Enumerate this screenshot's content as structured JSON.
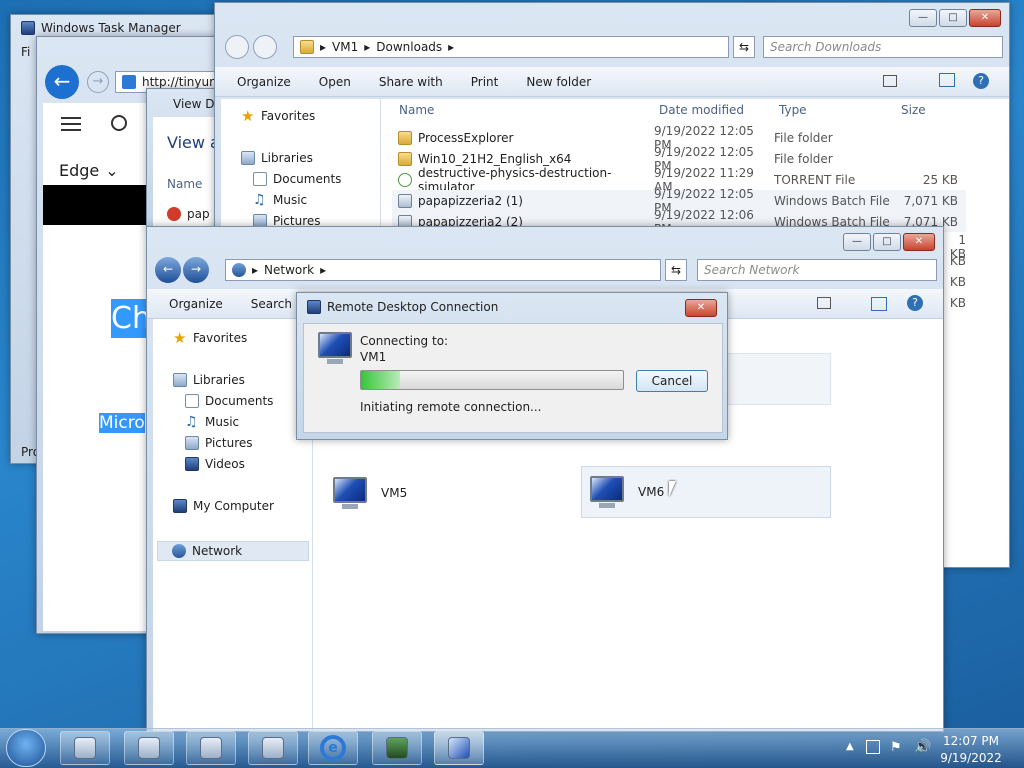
{
  "task_manager": {
    "title": "Windows Task Manager",
    "menu_first": "Fi",
    "status_first": "Pro"
  },
  "edge": {
    "address": "http://tinyurl.",
    "edge_label": "Edge",
    "highlight_big": "Ch",
    "highlight_small": "Micro"
  },
  "view_win": {
    "title": "View Do",
    "heading": "View a",
    "col_name": "Name",
    "row1": "pap"
  },
  "downloads": {
    "address": [
      "VM1",
      "Downloads"
    ],
    "search_placeholder": "Search Downloads",
    "toolbar": [
      "Organize",
      "Open",
      "Share with",
      "Print",
      "New folder"
    ],
    "nav": {
      "favorites": "Favorites",
      "libraries": "Libraries",
      "documents": "Documents",
      "music": "Music",
      "pictures": "Pictures"
    },
    "columns": [
      "Name",
      "Date modified",
      "Type",
      "Size"
    ],
    "files": [
      {
        "name": "ProcessExplorer",
        "date": "9/19/2022 12:05 PM",
        "type": "File folder",
        "size": "",
        "icon": "folder-icon"
      },
      {
        "name": "Win10_21H2_English_x64",
        "date": "9/19/2022 12:05 PM",
        "type": "File folder",
        "size": "",
        "icon": "folder-icon"
      },
      {
        "name": "destructive-physics-destruction-simulator",
        "date": "9/19/2022 11:29 AM",
        "type": "TORRENT File",
        "size": "25 KB",
        "icon": "torrent-icon"
      },
      {
        "name": "papapizzeria2 (1)",
        "date": "9/19/2022 12:05 PM",
        "type": "Windows Batch File",
        "size": "7,071 KB",
        "icon": "batch-file-icon"
      },
      {
        "name": "papapizzeria2 (2)",
        "date": "9/19/2022 12:06 PM",
        "type": "Windows Batch File",
        "size": "7,071 KB",
        "icon": "batch-file-icon"
      }
    ],
    "hidden_sizes": [
      "1 KB",
      "KB",
      "KB",
      "KB",
      "KB"
    ]
  },
  "network": {
    "address": "Network",
    "search_placeholder": "Search Network",
    "toolbar": [
      "Organize",
      "Search"
    ],
    "nav": {
      "favorites": "Favorites",
      "libraries": "Libraries",
      "documents": "Documents",
      "music": "Music",
      "pictures": "Pictures",
      "videos": "Videos",
      "my_computer": "My Computer",
      "network": "Network"
    },
    "computers": [
      "VM5",
      "VM6"
    ]
  },
  "rdc": {
    "title": "Remote Desktop Connection",
    "connecting_to": "Connecting to:",
    "target": "VM1",
    "cancel": "Cancel",
    "status": "Initiating remote connection...",
    "progress": 0.15
  },
  "taskbar": {
    "time": "12:07 PM",
    "date": "9/19/2022"
  },
  "colors": {
    "accent": "#3399ff",
    "progress": "#37c43a"
  }
}
